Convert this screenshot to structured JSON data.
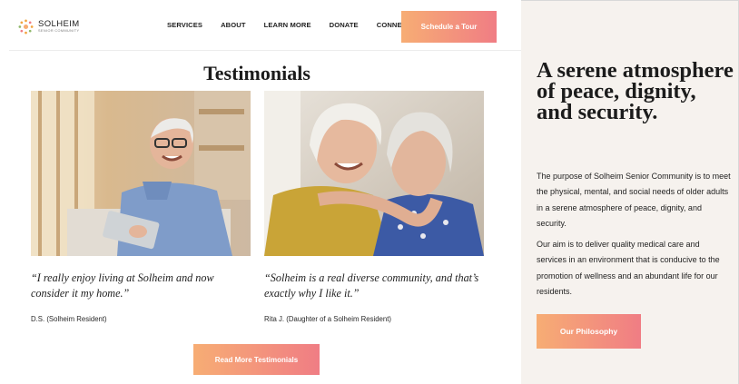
{
  "brand": {
    "name": "SOLHEIM",
    "tagline": "SENIOR COMMUNITY",
    "logo_icon": "sunburst-logo-icon"
  },
  "nav": {
    "items": [
      {
        "label": "SERVICES"
      },
      {
        "label": "ABOUT"
      },
      {
        "label": "LEARN MORE"
      },
      {
        "label": "DONATE"
      },
      {
        "label": "CONNECT"
      }
    ],
    "cta_label": "Schedule a Tour"
  },
  "testimonials": {
    "title": "Testimonials",
    "items": [
      {
        "quote": "“I really enjoy living at Solheim and now consider it my home.”",
        "author": "D.S. (Solheim Resident)"
      },
      {
        "quote": "“Solheim is a real diverse community, and that’s exactly why I like it.”",
        "author": "Rita J. (Daughter of a Solheim Resident)"
      }
    ],
    "more_label": "Read More Testimonials"
  },
  "about": {
    "headline": "A serene atmosphere of peace, dignity, and security.",
    "paragraphs": [
      "The purpose of Solheim Senior Community is to meet the physical, mental, and social needs of older adults in a serene atmosphere of peace, dignity, and security.",
      "Our aim is to deliver quality medical care and services in an environment that is conducive to the promotion of wellness and an abundant life for our residents."
    ],
    "button_label": "Our Philosophy"
  },
  "colors": {
    "accent_start": "#f7ad74",
    "accent_end": "#f07d84",
    "sidebar_bg": "#f6f2ee"
  }
}
